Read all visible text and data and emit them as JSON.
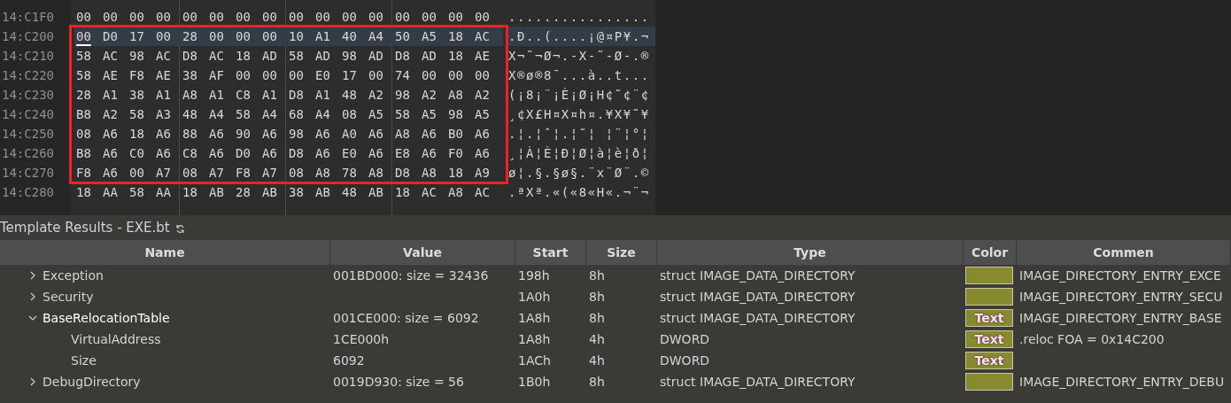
{
  "hex_view": {
    "rows": [
      {
        "address": "14:C1F0",
        "hex": "00 00 00 00 00 00 00 00 00 00 00 00 00 00 00 00",
        "ascii": "................",
        "selected": false,
        "marked": false
      },
      {
        "address": "14:C200",
        "hex": "00 D0 17 00 28 00 00 00 10 A1 40 A4 50 A5 18 AC",
        "ascii": ".Ð..(....¡@¤P¥.¬",
        "selected": true,
        "marked": true
      },
      {
        "address": "14:C210",
        "hex": "58 AC 98 AC D8 AC 18 AD 58 AD 98 AD D8 AD 18 AE",
        "ascii": "X¬˜¬Ø¬.-X-˜-Ø-.®",
        "selected": false,
        "marked": true
      },
      {
        "address": "14:C220",
        "hex": "58 AE F8 AE 38 AF 00 00 00 E0 17 00 74 00 00 00",
        "ascii": "X®ø®8¯...à..t...",
        "selected": false,
        "marked": true
      },
      {
        "address": "14:C230",
        "hex": "28 A1 38 A1 A8 A1 C8 A1 D8 A1 48 A2 98 A2 A8 A2",
        "ascii": "(¡8¡¨¡È¡Ø¡H¢˜¢¨¢",
        "selected": false,
        "marked": true
      },
      {
        "address": "14:C240",
        "hex": "B8 A2 58 A3 48 A4 58 A4 68 A4 08 A5 58 A5 98 A5",
        "ascii": "¸¢X£H¤X¤h¤.¥X¥˜¥",
        "selected": false,
        "marked": true
      },
      {
        "address": "14:C250",
        "hex": "08 A6 18 A6 88 A6 90 A6 98 A6 A0 A6 A8 A6 B0 A6",
        "ascii": ".¦.¦ˆ¦.¦˜¦ ¦¨¦°¦",
        "selected": false,
        "marked": true
      },
      {
        "address": "14:C260",
        "hex": "B8 A6 C0 A6 C8 A6 D0 A6 D8 A6 E0 A6 E8 A6 F0 A6",
        "ascii": "¸¦À¦È¦Ð¦Ø¦à¦è¦ð¦",
        "selected": false,
        "marked": true
      },
      {
        "address": "14:C270",
        "hex": "F8 A6 00 A7 08 A7 F8 A7 08 A8 78 A8 D8 A8 18 A9",
        "ascii": "ø¦.§.§ø§.¨x¨Ø¨.©",
        "selected": false,
        "marked": true
      },
      {
        "address": "14:C280",
        "hex": "18 AA 58 AA 18 AB 28 AB 38 AB 48 AB 18 AC A8 AC",
        "ascii": ".ªXª.«(«8«H«.¬¨¬",
        "selected": false,
        "marked": false
      }
    ]
  },
  "template_results": {
    "title": "Template Results - EXE.bt",
    "columns": [
      "Name",
      "Value",
      "Start",
      "Size",
      "Type",
      "Color",
      "Commen"
    ],
    "rows": [
      {
        "name": "Exception",
        "value": "001BD000: size = 32436",
        "start": "198h",
        "size": "8h",
        "type": "struct IMAGE_DATA_DIRECTORY",
        "color": "#878a2e",
        "comment": "IMAGE_DIRECTORY_ENTRY_EXCE",
        "expanded": false
      },
      {
        "name": "Security",
        "start": "1A0h",
        "size": "8h",
        "type": "struct IMAGE_DATA_DIRECTORY",
        "color": "#878a2e",
        "comment": "IMAGE_DIRECTORY_ENTRY_SECU",
        "expanded": false
      },
      {
        "name": "BaseRelocationTable",
        "value": "001CE000: size = 6092",
        "start": "1A8h",
        "size": "8h",
        "type": "struct IMAGE_DATA_DIRECTORY",
        "color": "#878a2e",
        "swatch_text": "Text",
        "comment": "IMAGE_DIRECTORY_ENTRY_BASE",
        "expanded": true,
        "children": [
          {
            "name": "VirtualAddress",
            "value": "1CE000h",
            "start": "1A8h",
            "size": "4h",
            "type": "DWORD",
            "color": "#878a2e",
            "swatch_text": "Text",
            "comment": ".reloc FOA = 0x14C200"
          },
          {
            "name": "Size",
            "value": "6092",
            "start": "1ACh",
            "size": "4h",
            "type": "DWORD",
            "color": "#878a2e",
            "swatch_text": "Text"
          }
        ]
      },
      {
        "name": "DebugDirectory",
        "value": "0019D930: size = 56",
        "start": "1B0h",
        "size": "8h",
        "type": "struct IMAGE_DATA_DIRECTORY",
        "color": "#878a2e",
        "comment": "IMAGE_DIRECTORY_ENTRY_DEBU",
        "expanded": false
      }
    ]
  }
}
